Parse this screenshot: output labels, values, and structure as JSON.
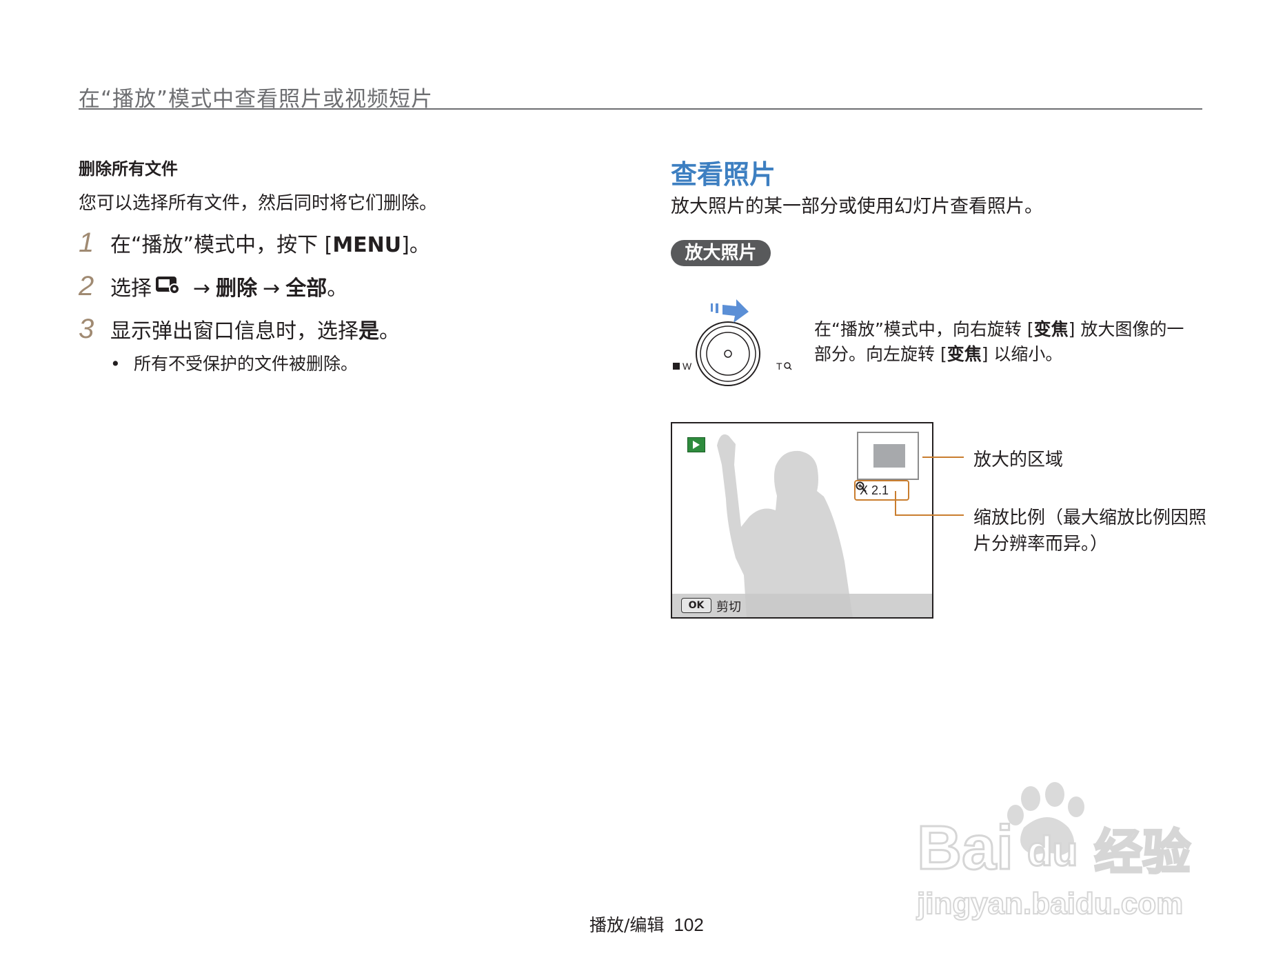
{
  "header": {
    "title": "在“播放”模式中查看照片或视频短片"
  },
  "left": {
    "section_title": "删除所有文件",
    "section_desc": "您可以选择所有文件，然后同时将它们删除。",
    "steps": [
      {
        "num": "1",
        "text_a": "在“播放”模式中，按下 [",
        "bold": "MENU",
        "text_b": "]。"
      },
      {
        "num": "2",
        "text_a": "选择",
        "arrow1": "→",
        "b1": "删除",
        "arrow2": "→",
        "b2": "全部",
        "end": "。"
      },
      {
        "num": "3",
        "text_a": "显示弹出窗口信息时，选择",
        "bold": "是",
        "text_b": "。"
      }
    ],
    "bullet": "所有不受保护的文件被删除。"
  },
  "right": {
    "title": "查看照片",
    "desc": "放大照片的某一部分或使用幻灯片查看照片。",
    "pill": "放大照片",
    "dial": {
      "w_label": "W",
      "t_label": "T"
    },
    "zoom_text": {
      "p1": "在“播放”模式中，向右旋转 [",
      "b1": "变焦",
      "p2": "] 放大图像的一部分。向左旋转 [",
      "b2": "变焦",
      "p3": "] 以缩小。"
    },
    "screen": {
      "ok_label": "OK",
      "cut_label": "剪切",
      "zoom_badge": "X 2.1"
    },
    "callouts": {
      "area": "放大的区域",
      "ratio": "缩放比例（最大缩放比例因照片分辨率而异。）"
    }
  },
  "footer": {
    "section": "播放/编辑",
    "page": "102"
  },
  "watermark": {
    "brand": "Bai",
    "brand2": "du",
    "brand_cn": "经验",
    "url": "jingyan.baidu.com"
  },
  "colors": {
    "accent_blue": "#3d7fc1",
    "step_num": "#a08a72",
    "callout": "#c97d2e",
    "pill_bg": "#58595b"
  },
  "icons": [
    "menu-playback-settings-icon",
    "zoom-dial-icon",
    "play-mode-icon",
    "magnifier-icon"
  ]
}
